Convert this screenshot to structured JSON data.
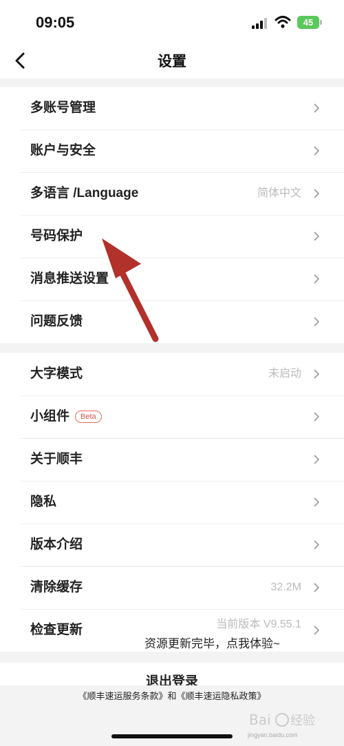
{
  "status": {
    "time": "09:05",
    "battery": "45"
  },
  "nav": {
    "title": "设置"
  },
  "group1": [
    {
      "label": "多账号管理",
      "value": ""
    },
    {
      "label": "账户与安全",
      "value": ""
    },
    {
      "label": "多语言 /Language",
      "value": "简体中文"
    },
    {
      "label": "号码保护",
      "value": ""
    },
    {
      "label": "消息推送设置",
      "value": ""
    },
    {
      "label": "问题反馈",
      "value": ""
    }
  ],
  "group2": [
    {
      "label": "大字模式",
      "value": "未启动"
    },
    {
      "label": "小组件",
      "badge": "Beta",
      "value": ""
    },
    {
      "label": "关于顺丰",
      "value": ""
    },
    {
      "label": "隐私",
      "value": ""
    },
    {
      "label": "版本介绍",
      "value": ""
    },
    {
      "label": "清除缓存",
      "value": "32.2M"
    },
    {
      "label": "检查更新",
      "current_version": "当前版本 V9.55.1"
    }
  ],
  "toast": "资源更新完毕，点我体验~",
  "logout": "退出登录",
  "footer": {
    "terms": "《顺丰速运服务条款》和《顺丰速运隐私政策》"
  },
  "watermark": {
    "brand": "Bai",
    "brand2": "经验",
    "url": "jingyan.baidu.com"
  },
  "colors": {
    "accent_arrow": "#b3312b",
    "battery": "#5ac85a",
    "badge": "#d9534f"
  }
}
